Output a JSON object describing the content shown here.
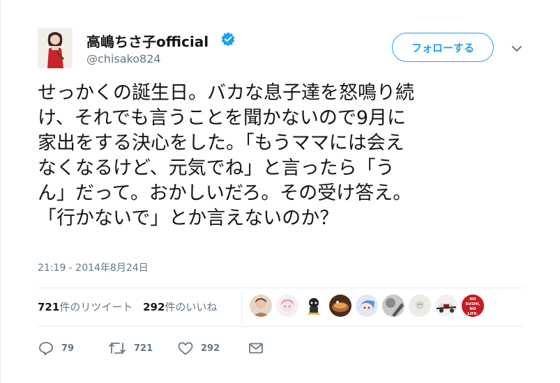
{
  "author": {
    "display_name": "高嶋ちさ子official",
    "handle": "@chisako824",
    "verified": true
  },
  "follow_button": {
    "label": "フォローする"
  },
  "tweet": {
    "lines": [
      "せっかくの誕生日。バカな息子達を怒鳴り続",
      "け、それでも言うことを聞かないので9月に",
      "家出をする決心をした。「もうママには会え",
      "なくなるけど、元気でね」と言ったら「う",
      "ん」だって。おかしいだろ。その受け答え。",
      "「行かないで」とか言えないのか？"
    ],
    "timestamp": "21:19 - 2014年8月24日"
  },
  "stats": {
    "retweets_count": "721",
    "retweets_label": "件のリツイート",
    "likes_count": "292",
    "likes_label": "件のいいね"
  },
  "likers": [
    {
      "icon": "avatar-woman"
    },
    {
      "icon": "avatar-anime-pink"
    },
    {
      "icon": "avatar-character-dark"
    },
    {
      "icon": "avatar-food"
    },
    {
      "icon": "avatar-anime-blue"
    },
    {
      "icon": "avatar-gray-photo"
    },
    {
      "icon": "avatar-light-gray"
    },
    {
      "icon": "avatar-car"
    },
    {
      "icon": "avatar-red-badge",
      "text": [
        "NO",
        "SUSHI,",
        "NO",
        "LIFE."
      ]
    }
  ],
  "actions": {
    "reply_count": "79",
    "retweet_count": "721",
    "like_count": "292"
  },
  "colors": {
    "accent": "#1da1f2",
    "text": "#14171a",
    "muted": "#657786",
    "divider": "#e6ecf0"
  }
}
